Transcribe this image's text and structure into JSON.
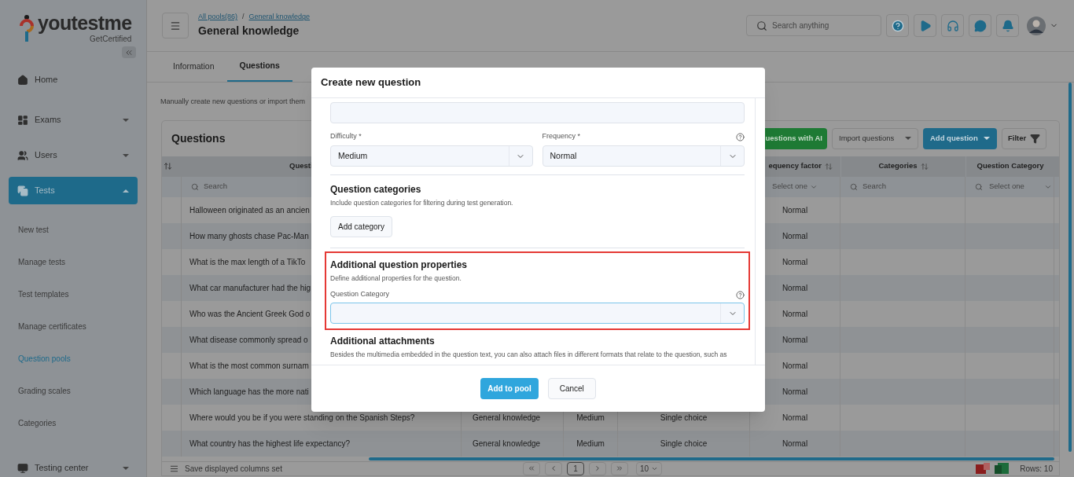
{
  "logo": {
    "name": "youtestme",
    "tagline": "GetCertified"
  },
  "sidebar": {
    "items": [
      {
        "label": "Home",
        "kind": "link",
        "selected": false
      },
      {
        "label": "Exams",
        "kind": "group",
        "expanded": false,
        "selected": false
      },
      {
        "label": "Users",
        "kind": "group",
        "expanded": false,
        "selected": false
      },
      {
        "label": "Tests",
        "kind": "group",
        "expanded": true,
        "selected": true,
        "children": [
          {
            "label": "New test",
            "selected": false
          },
          {
            "label": "Manage tests",
            "selected": false
          },
          {
            "label": "Test templates",
            "selected": false
          },
          {
            "label": "Manage certificates",
            "selected": false
          },
          {
            "label": "Question pools",
            "selected": true
          },
          {
            "label": "Grading scales",
            "selected": false
          },
          {
            "label": "Categories",
            "selected": false
          }
        ]
      },
      {
        "label": "Testing center",
        "kind": "group",
        "expanded": false,
        "selected": false
      }
    ]
  },
  "header": {
    "breadcrumbs": [
      "All pools(86)",
      "General knowledge"
    ],
    "separator": "/",
    "title": "General knowledge",
    "search": {
      "placeholder": "Search anything"
    }
  },
  "tabs": [
    {
      "label": "Information",
      "selected": false
    },
    {
      "label": "Questions",
      "selected": true
    }
  ],
  "intro": "Manually create new questions or import them",
  "table": {
    "title": "Questions",
    "actions": [
      {
        "label": "uestions with AI",
        "kind": "green"
      },
      {
        "label": "Import questions",
        "kind": "dropdown"
      },
      {
        "label": "Add question",
        "kind": "primary-dropdown"
      },
      {
        "label": "Filter",
        "kind": "filter"
      }
    ],
    "columns": [
      {
        "label": "Questi",
        "kind": "search",
        "placeholder": "Search"
      },
      {
        "kind": "none"
      },
      {
        "kind": "none"
      },
      {
        "kind": "none"
      },
      {
        "label": "equency factor",
        "sortable": true,
        "kind": "select",
        "placeholder": "Select one"
      },
      {
        "label": "Categories",
        "sortable": true,
        "kind": "search",
        "placeholder": "Search"
      },
      {
        "label": "Question Category",
        "sortable": false,
        "kind": "search-select",
        "placeholder": "Select one"
      }
    ],
    "rows": [
      {
        "cells": [
          "Halloween originated as an ancien",
          null,
          null,
          null,
          "Normal",
          null,
          null
        ]
      },
      {
        "cells": [
          "How many ghosts chase Pac-Man",
          null,
          null,
          null,
          "Normal",
          null,
          null
        ]
      },
      {
        "cells": [
          "What is the max length of a TikTo",
          null,
          null,
          null,
          "Normal",
          null,
          null
        ]
      },
      {
        "cells": [
          "What car manufacturer had the hig",
          null,
          null,
          null,
          "Normal",
          null,
          null
        ]
      },
      {
        "cells": [
          "Who was the Ancient Greek God o",
          null,
          null,
          null,
          "Normal",
          null,
          null
        ]
      },
      {
        "cells": [
          "What disease commonly spread o",
          null,
          null,
          null,
          "Normal",
          null,
          null
        ]
      },
      {
        "cells": [
          "What is the most common surnam",
          null,
          null,
          null,
          "Normal",
          null,
          null
        ]
      },
      {
        "cells": [
          "Which language has the more nati",
          null,
          null,
          null,
          "Normal",
          null,
          null
        ]
      },
      {
        "cells": [
          "Where would you be if you were standing on the Spanish Steps?",
          "General knowledge",
          "Medium",
          "Single choice",
          "Normal",
          null,
          null
        ]
      },
      {
        "cells": [
          "What country has the highest life expectancy?",
          "General knowledge",
          "Medium",
          "Single choice",
          "Normal",
          null,
          null
        ]
      }
    ],
    "footer": {
      "save_label": "Save displayed columns set",
      "pages": [
        {
          "label": "1",
          "selected": true
        }
      ],
      "page_size": "10",
      "rows_label": "Rows: 10"
    }
  },
  "modal": {
    "title": "Create new question",
    "fields": [
      {
        "label": "Difficulty *",
        "value": "Medium",
        "help": false
      },
      {
        "label": "Frequency *",
        "value": "Normal",
        "help": true
      }
    ],
    "sections": [
      {
        "title": "Question categories",
        "description": "Include question categories for filtering during test generation.",
        "button": "Add category",
        "highlighted": false
      },
      {
        "title": "Additional question properties",
        "description": "Define additional properties for the question.",
        "field": {
          "label": "Question Category",
          "help": true,
          "focused": true
        },
        "highlighted": true
      },
      {
        "title": "Additional attachments",
        "description": "Besides the multimedia embedded in the question text, you can also attach files in different formats that relate to the question, such as",
        "highlighted": false
      }
    ],
    "buttons": [
      {
        "label": "Add to pool",
        "kind": "primary"
      },
      {
        "label": "Cancel",
        "kind": "secondary"
      }
    ]
  }
}
